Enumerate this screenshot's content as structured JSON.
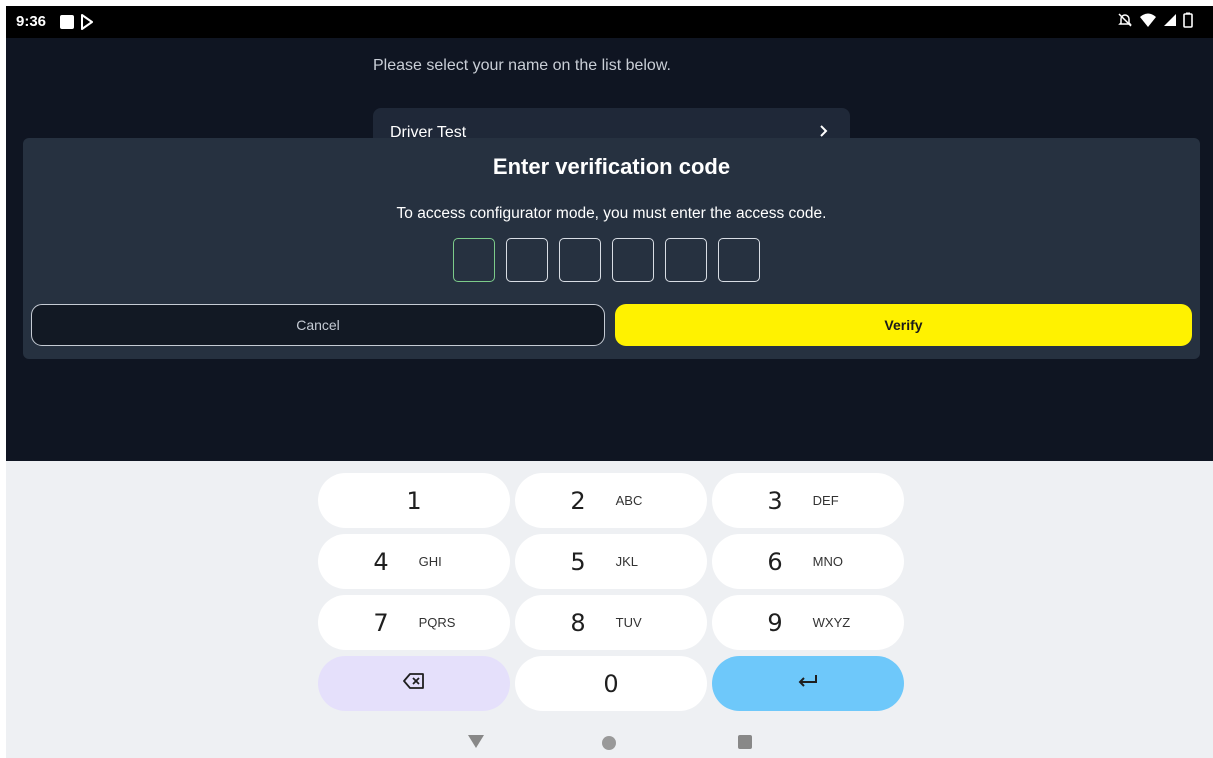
{
  "status_bar": {
    "time": "9:36",
    "icons": [
      "notification-square-icon",
      "play-store-icon",
      "dnd-off-icon",
      "wifi-icon",
      "signal-icon",
      "battery-icon"
    ]
  },
  "background": {
    "instruction": "Please select your name on the list below.",
    "list_item_label": "Driver Test"
  },
  "dialog": {
    "title": "Enter verification code",
    "message": "To access configurator mode, you must enter the access code.",
    "code_digits": [
      "",
      "",
      "",
      "",
      "",
      ""
    ],
    "cancel_label": "Cancel",
    "verify_label": "Verify",
    "verify_color": "#fff200"
  },
  "keyboard": {
    "keys": [
      {
        "num": "1",
        "letters": ""
      },
      {
        "num": "2",
        "letters": "ABC"
      },
      {
        "num": "3",
        "letters": "DEF"
      },
      {
        "num": "4",
        "letters": "GHI"
      },
      {
        "num": "5",
        "letters": "JKL"
      },
      {
        "num": "6",
        "letters": "MNO"
      },
      {
        "num": "7",
        "letters": "PQRS"
      },
      {
        "num": "8",
        "letters": "TUV"
      },
      {
        "num": "9",
        "letters": "WXYZ"
      },
      {
        "num": "0",
        "letters": ""
      }
    ],
    "backspace_color": "#e5e0fb",
    "enter_color": "#6ec8fa"
  }
}
